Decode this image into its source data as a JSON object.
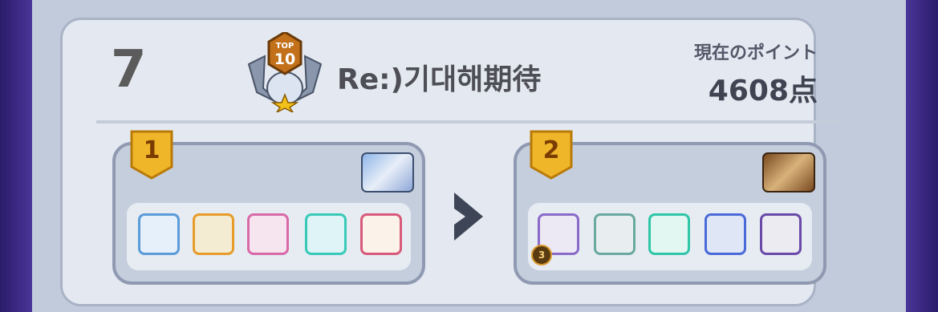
{
  "entry": {
    "rank": "7",
    "badge_icon": "top10-trophy-icon",
    "badge_text_top": "TOP",
    "badge_text_num": "10",
    "name": "Re:)기대해期待",
    "points_label": "現在のポイント",
    "points_value": "4608点"
  },
  "teams": [
    {
      "number": "1",
      "relic_icon": "ice-crystal-relic-icon",
      "items": [
        {
          "icon": "blue-shield-skill-icon",
          "color": "#5a9bd8"
        },
        {
          "icon": "infinity-skill-icon",
          "color": "#e79b2a"
        },
        {
          "icon": "crossed-swords-skill-icon",
          "color": "#d86aa8"
        },
        {
          "icon": "lotus-skill-icon",
          "color": "#38c9b8"
        },
        {
          "icon": "prism-skill-icon",
          "color": "#d85a7a"
        }
      ]
    },
    {
      "number": "2",
      "relic_icon": "parchment-relic-icon",
      "items": [
        {
          "icon": "vortex-skill-icon",
          "color": "#8a6ac8",
          "level": "3"
        },
        {
          "icon": "music-sheet-skill-icon",
          "color": "#6aa8a0"
        },
        {
          "icon": "teal-orb-skill-icon",
          "color": "#2fc6a8"
        },
        {
          "icon": "wave-spiral-skill-icon",
          "color": "#4a6ad8"
        },
        {
          "icon": "void-star-skill-icon",
          "color": "#6a4aa8"
        }
      ]
    }
  ],
  "arrow_icon": "chevron-right-icon"
}
